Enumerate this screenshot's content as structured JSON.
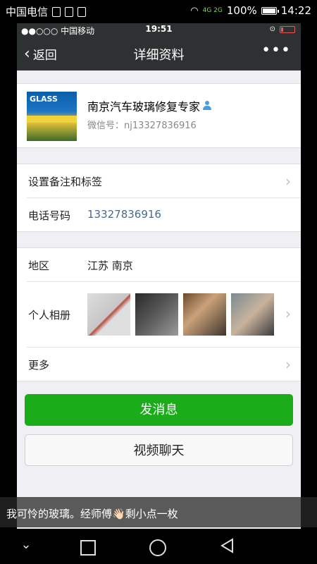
{
  "outer_status": {
    "carrier": "中国电信",
    "network": "4G 2G",
    "battery": "100%",
    "time": "14:22"
  },
  "inner_status": {
    "carrier": "●●○○○ 中国移动",
    "time": "19:51"
  },
  "nav": {
    "back_label": "返回",
    "title": "详细资料",
    "more_label": "•••"
  },
  "profile": {
    "avatar_text": "GLASS",
    "name": "南京汽车玻璃修复专家",
    "wechat_id": "微信号：nj13327836916"
  },
  "rows": {
    "remark": {
      "label": "设置备注和标签"
    },
    "phone": {
      "label": "电话号码",
      "value": "13327836916"
    },
    "region": {
      "label": "地区",
      "value": "江苏  南京"
    },
    "album": {
      "label": "个人相册"
    },
    "more": {
      "label": "更多"
    }
  },
  "buttons": {
    "send_message": "发消息",
    "video_chat": "视频聊天"
  },
  "caption": "我可怜的玻璃。经师傅👋🏻剩小点一枚",
  "colors": {
    "accent_green": "#1aad19",
    "nav_bg": "#2e3132",
    "page_bg": "#efeff4"
  }
}
